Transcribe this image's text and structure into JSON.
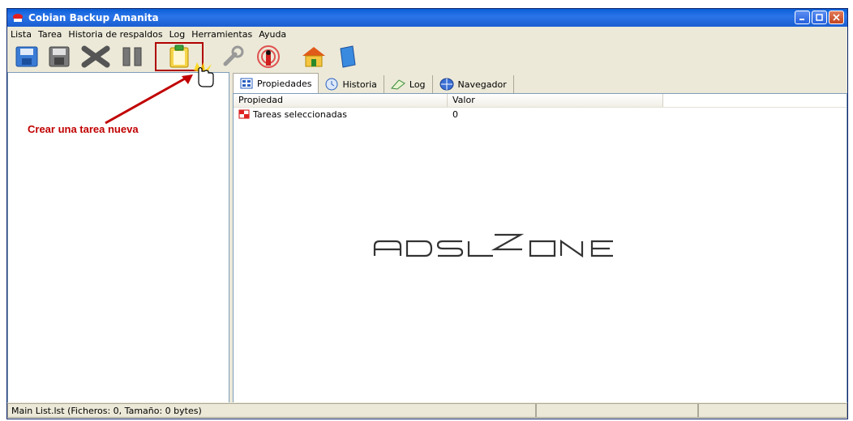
{
  "window": {
    "title": "Cobian Backup Amanita"
  },
  "menu": {
    "items": [
      "Lista",
      "Tarea",
      "Historia de respaldos",
      "Log",
      "Herramientas",
      "Ayuda"
    ]
  },
  "toolbar": {
    "buttons": [
      {
        "icon": "save-list-icon"
      },
      {
        "icon": "save-icon"
      },
      {
        "icon": "delete-icon"
      },
      {
        "icon": "pause-icon"
      },
      {
        "icon": "new-task-icon"
      },
      {
        "icon": "tools-icon"
      },
      {
        "icon": "broadcast-icon"
      },
      {
        "icon": "home-icon"
      },
      {
        "icon": "help-book-icon"
      }
    ]
  },
  "annotation": {
    "callout": "Crear una tarea nueva"
  },
  "tabs": [
    {
      "label": "Propiedades",
      "icon": "properties-icon"
    },
    {
      "label": "Historia",
      "icon": "clock-icon"
    },
    {
      "label": "Log",
      "icon": "log-icon"
    },
    {
      "label": "Navegador",
      "icon": "browser-icon"
    }
  ],
  "properties": {
    "columns": [
      "Propiedad",
      "Valor"
    ],
    "rows": [
      {
        "property": "Tareas seleccionadas",
        "value": "0"
      }
    ]
  },
  "statusbar": {
    "text": "Main List.lst (Ficheros: 0, Tamaño: 0 bytes)"
  },
  "colors": {
    "titlebar": "#1b5fd1",
    "callout": "#c00000",
    "highlight": "#b00000"
  }
}
